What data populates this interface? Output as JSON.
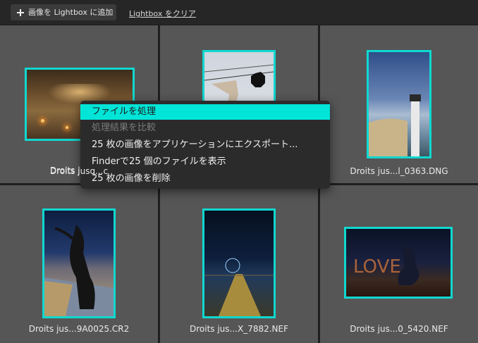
{
  "toolbar": {
    "add_label": "画像を Lightbox に追加",
    "clear_label": "Lightbox をクリア"
  },
  "grid": {
    "captions": [
      "Droits jusq...c",
      "",
      "Droits jus...l_0363.DNG",
      "Droits jus...9A0025.CR2",
      "Droits jus...X_7882.NEF",
      "Droits jus...0_5420.NEF"
    ]
  },
  "context_menu": {
    "items": [
      {
        "label": "ファイルを処理",
        "state": "highlighted"
      },
      {
        "label": "処理結果を比較",
        "state": "disabled"
      },
      {
        "label": "25 枚の画像をアプリケーションにエクスポート...",
        "state": "enabled"
      },
      {
        "label": "Finderで25 個のファイルを表示",
        "state": "enabled"
      },
      {
        "label": "25 枚の画像を削除",
        "state": "enabled"
      }
    ]
  },
  "colors": {
    "accent": "#00e5d8",
    "thumb_border": "#10d8d0",
    "cell_bg": "#565656",
    "menu_bg": "#2b2b2b"
  }
}
